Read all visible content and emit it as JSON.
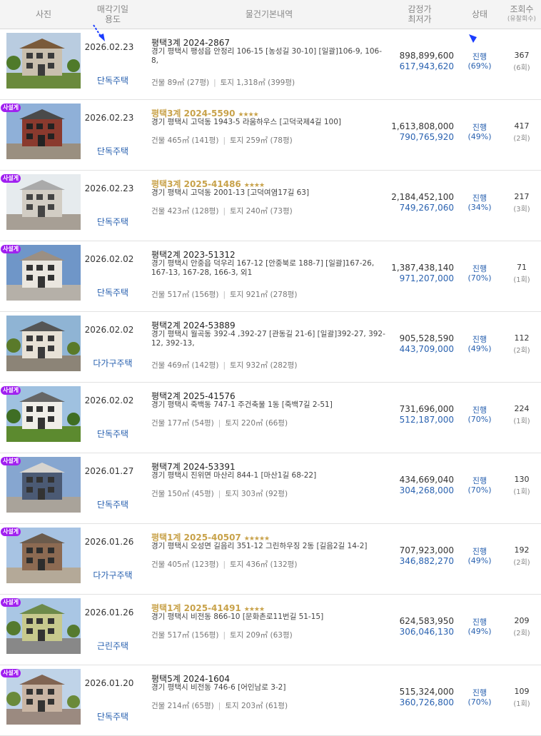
{
  "header": {
    "photo": "사진",
    "date_line1": "매각기일",
    "date_line2": "용도",
    "info": "물건기본내역",
    "price_line1": "감정가",
    "price_line2": "최저가",
    "status": "상태",
    "views_line1": "조회수",
    "views_line2": "(유찰회수)"
  },
  "listings": [
    {
      "badge": "",
      "date": "2026.02.23",
      "usage": "단독주택",
      "case": "평택3계 2024-2867",
      "stars": "",
      "addr": "경기 평택시 팽성읍 안정리 106-15 [농성길 30-10] [일괄]106-9, 106-8,",
      "area_bldg": "건물 89㎡ (27평)",
      "area_land": "토지 1,318㎡ (399평)",
      "appraisal": "898,899,600",
      "min_price": "617,943,620",
      "status": "진행",
      "pct": "(69%)",
      "views": "367",
      "fails": "(6회)"
    },
    {
      "badge": "사설게",
      "date": "2026.02.23",
      "usage": "단독주택",
      "case": "평택3계 2024-5590",
      "stars": "★★★★",
      "addr": "경기 평택시 고덕동 1943-5 라움하우스 [고덕국제4길 100]",
      "area_bldg": "건물 465㎡ (141평)",
      "area_land": "토지 259㎡ (78평)",
      "appraisal": "1,613,808,000",
      "min_price": "790,765,920",
      "status": "진행",
      "pct": "(49%)",
      "views": "417",
      "fails": "(2회)"
    },
    {
      "badge": "사설게",
      "date": "2026.02.23",
      "usage": "단독주택",
      "case": "평택3계 2025-41486",
      "stars": "★★★★",
      "addr": "경기 평택시 고덕동 2001-13 [고덕여염17길 63]",
      "area_bldg": "건물 423㎡ (128평)",
      "area_land": "토지 240㎡ (73평)",
      "appraisal": "2,184,452,100",
      "min_price": "749,267,060",
      "status": "진행",
      "pct": "(34%)",
      "views": "217",
      "fails": "(3회)"
    },
    {
      "badge": "사설게",
      "date": "2026.02.02",
      "usage": "단독주택",
      "case": "평택2계 2023-51312",
      "stars": "",
      "addr": "경기 평택시 안중읍 덕우리 167-12 [안중북로 188-7] [일괄]167-26, 167-13, 167-28, 166-3, 외1",
      "area_bldg": "건물 517㎡ (156평)",
      "area_land": "토지 921㎡ (278평)",
      "appraisal": "1,387,438,140",
      "min_price": "971,207,000",
      "status": "진행",
      "pct": "(70%)",
      "views": "71",
      "fails": "(1회)"
    },
    {
      "badge": "",
      "date": "2026.02.02",
      "usage": "다가구주택",
      "case": "평택2계 2024-53889",
      "stars": "",
      "addr": "경기 평택시 월곡동 392-4 ,392-27 [관동길 21-6] [일괄]392-27, 392-12, 392-13,",
      "area_bldg": "건물 469㎡ (142평)",
      "area_land": "토지 932㎡ (282평)",
      "appraisal": "905,528,590",
      "min_price": "443,709,000",
      "status": "진행",
      "pct": "(49%)",
      "views": "112",
      "fails": "(2회)"
    },
    {
      "badge": "사설게",
      "date": "2026.02.02",
      "usage": "단독주택",
      "case": "평택2계 2025-41576",
      "stars": "",
      "addr": "경기 평택시 죽백동 747-1 주건축물 1동 [죽백7길 2-51]",
      "area_bldg": "건물 177㎡ (54평)",
      "area_land": "토지 220㎡ (66평)",
      "appraisal": "731,696,000",
      "min_price": "512,187,000",
      "status": "진행",
      "pct": "(70%)",
      "views": "224",
      "fails": "(1회)"
    },
    {
      "badge": "사설게",
      "date": "2026.01.27",
      "usage": "단독주택",
      "case": "평택7계 2024-53391",
      "stars": "",
      "addr": "경기 평택시 진위면 마산리 844-1 [마산1길 68-22]",
      "area_bldg": "건물 150㎡ (45평)",
      "area_land": "토지 303㎡ (92평)",
      "appraisal": "434,669,040",
      "min_price": "304,268,000",
      "status": "진행",
      "pct": "(70%)",
      "views": "130",
      "fails": "(1회)"
    },
    {
      "badge": "사설게",
      "date": "2026.01.26",
      "usage": "다가구주택",
      "case": "평택1계 2025-40507",
      "stars": "★★★★★",
      "addr": "경기 평택시 오성면 길음리 351-12 그린하우징 2동 [길음2길 14-2]",
      "area_bldg": "건물 405㎡ (123평)",
      "area_land": "토지 436㎡ (132평)",
      "appraisal": "707,923,000",
      "min_price": "346,882,270",
      "status": "진행",
      "pct": "(49%)",
      "views": "192",
      "fails": "(2회)"
    },
    {
      "badge": "사설게",
      "date": "2026.01.26",
      "usage": "근린주택",
      "case": "평택1계 2025-41491",
      "stars": "★★★★",
      "addr": "경기 평택시 비전동 866-10 [문화촌로11번길 51-15]",
      "area_bldg": "건물 517㎡ (156평)",
      "area_land": "토지 209㎡ (63평)",
      "appraisal": "624,583,950",
      "min_price": "306,046,130",
      "status": "진행",
      "pct": "(49%)",
      "views": "209",
      "fails": "(2회)"
    },
    {
      "badge": "사설게",
      "date": "2026.01.20",
      "usage": "단독주택",
      "case": "평택5계 2024-1604",
      "stars": "",
      "addr": "경기 평택시 비전동 746-6 [어인남로 3-2]",
      "area_bldg": "건물 214㎡ (65평)",
      "area_land": "토지 203㎡ (61평)",
      "appraisal": "515,324,000",
      "min_price": "360,726,800",
      "status": "진행",
      "pct": "(70%)",
      "views": "109",
      "fails": "(1회)"
    }
  ]
}
